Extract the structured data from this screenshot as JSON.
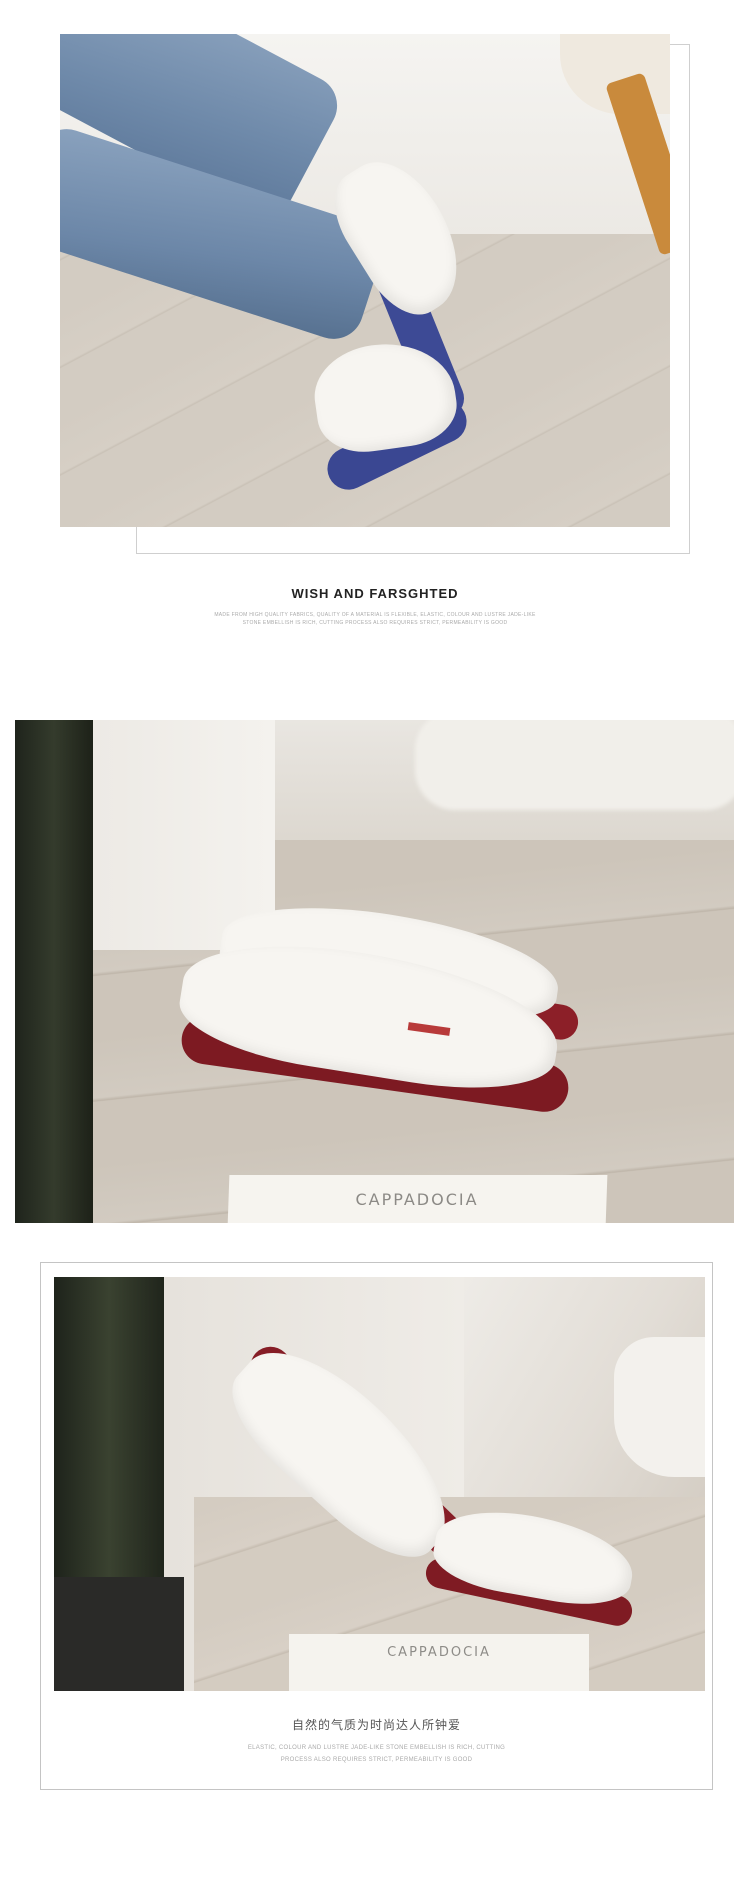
{
  "section1": {
    "title": "WISH AND FARSGHTED",
    "subtitle_line1": "MADE FROM HIGH QUALITY FABRICS, QUALITY OF A MATERIAL IS FLEXIBLE, ELASTIC, COLOUR AND LUSTRE JADE-LIKE",
    "subtitle_line2": "STONE EMBELLISH IS RICH, CUTTING PROCESS ALSO REQUIRES STRICT, PERMEABILITY IS GOOD"
  },
  "section2": {
    "card_text": "CAPPADOCIA"
  },
  "section3": {
    "card_text": "CAPPADOCIA",
    "title": "自然的气质为时尚达人所钟爱",
    "subtitle_line1": "ELASTIC, COLOUR AND LUSTRE JADE-LIKE STONE EMBELLISH IS RICH, CUTTING",
    "subtitle_line2": "PROCESS ALSO REQUIRES STRICT, PERMEABILITY IS GOOD"
  },
  "colors": {
    "sole_blue": "#3d4a95",
    "sole_red": "#861d26"
  }
}
